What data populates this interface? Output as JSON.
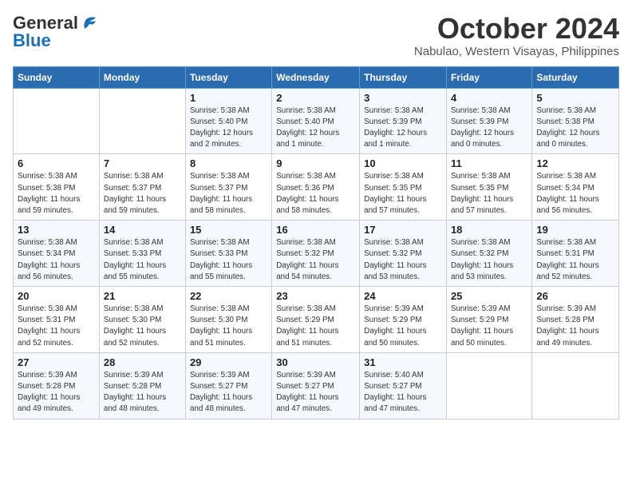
{
  "logo": {
    "line1": "General",
    "line2": "Blue"
  },
  "title": "October 2024",
  "location": "Nabulao, Western Visayas, Philippines",
  "days_header": [
    "Sunday",
    "Monday",
    "Tuesday",
    "Wednesday",
    "Thursday",
    "Friday",
    "Saturday"
  ],
  "weeks": [
    [
      {
        "day": "",
        "detail": ""
      },
      {
        "day": "",
        "detail": ""
      },
      {
        "day": "1",
        "detail": "Sunrise: 5:38 AM\nSunset: 5:40 PM\nDaylight: 12 hours\nand 2 minutes."
      },
      {
        "day": "2",
        "detail": "Sunrise: 5:38 AM\nSunset: 5:40 PM\nDaylight: 12 hours\nand 1 minute."
      },
      {
        "day": "3",
        "detail": "Sunrise: 5:38 AM\nSunset: 5:39 PM\nDaylight: 12 hours\nand 1 minute."
      },
      {
        "day": "4",
        "detail": "Sunrise: 5:38 AM\nSunset: 5:39 PM\nDaylight: 12 hours\nand 0 minutes."
      },
      {
        "day": "5",
        "detail": "Sunrise: 5:38 AM\nSunset: 5:38 PM\nDaylight: 12 hours\nand 0 minutes."
      }
    ],
    [
      {
        "day": "6",
        "detail": "Sunrise: 5:38 AM\nSunset: 5:38 PM\nDaylight: 11 hours\nand 59 minutes."
      },
      {
        "day": "7",
        "detail": "Sunrise: 5:38 AM\nSunset: 5:37 PM\nDaylight: 11 hours\nand 59 minutes."
      },
      {
        "day": "8",
        "detail": "Sunrise: 5:38 AM\nSunset: 5:37 PM\nDaylight: 11 hours\nand 58 minutes."
      },
      {
        "day": "9",
        "detail": "Sunrise: 5:38 AM\nSunset: 5:36 PM\nDaylight: 11 hours\nand 58 minutes."
      },
      {
        "day": "10",
        "detail": "Sunrise: 5:38 AM\nSunset: 5:35 PM\nDaylight: 11 hours\nand 57 minutes."
      },
      {
        "day": "11",
        "detail": "Sunrise: 5:38 AM\nSunset: 5:35 PM\nDaylight: 11 hours\nand 57 minutes."
      },
      {
        "day": "12",
        "detail": "Sunrise: 5:38 AM\nSunset: 5:34 PM\nDaylight: 11 hours\nand 56 minutes."
      }
    ],
    [
      {
        "day": "13",
        "detail": "Sunrise: 5:38 AM\nSunset: 5:34 PM\nDaylight: 11 hours\nand 56 minutes."
      },
      {
        "day": "14",
        "detail": "Sunrise: 5:38 AM\nSunset: 5:33 PM\nDaylight: 11 hours\nand 55 minutes."
      },
      {
        "day": "15",
        "detail": "Sunrise: 5:38 AM\nSunset: 5:33 PM\nDaylight: 11 hours\nand 55 minutes."
      },
      {
        "day": "16",
        "detail": "Sunrise: 5:38 AM\nSunset: 5:32 PM\nDaylight: 11 hours\nand 54 minutes."
      },
      {
        "day": "17",
        "detail": "Sunrise: 5:38 AM\nSunset: 5:32 PM\nDaylight: 11 hours\nand 53 minutes."
      },
      {
        "day": "18",
        "detail": "Sunrise: 5:38 AM\nSunset: 5:32 PM\nDaylight: 11 hours\nand 53 minutes."
      },
      {
        "day": "19",
        "detail": "Sunrise: 5:38 AM\nSunset: 5:31 PM\nDaylight: 11 hours\nand 52 minutes."
      }
    ],
    [
      {
        "day": "20",
        "detail": "Sunrise: 5:38 AM\nSunset: 5:31 PM\nDaylight: 11 hours\nand 52 minutes."
      },
      {
        "day": "21",
        "detail": "Sunrise: 5:38 AM\nSunset: 5:30 PM\nDaylight: 11 hours\nand 52 minutes."
      },
      {
        "day": "22",
        "detail": "Sunrise: 5:38 AM\nSunset: 5:30 PM\nDaylight: 11 hours\nand 51 minutes."
      },
      {
        "day": "23",
        "detail": "Sunrise: 5:38 AM\nSunset: 5:29 PM\nDaylight: 11 hours\nand 51 minutes."
      },
      {
        "day": "24",
        "detail": "Sunrise: 5:39 AM\nSunset: 5:29 PM\nDaylight: 11 hours\nand 50 minutes."
      },
      {
        "day": "25",
        "detail": "Sunrise: 5:39 AM\nSunset: 5:29 PM\nDaylight: 11 hours\nand 50 minutes."
      },
      {
        "day": "26",
        "detail": "Sunrise: 5:39 AM\nSunset: 5:28 PM\nDaylight: 11 hours\nand 49 minutes."
      }
    ],
    [
      {
        "day": "27",
        "detail": "Sunrise: 5:39 AM\nSunset: 5:28 PM\nDaylight: 11 hours\nand 49 minutes."
      },
      {
        "day": "28",
        "detail": "Sunrise: 5:39 AM\nSunset: 5:28 PM\nDaylight: 11 hours\nand 48 minutes."
      },
      {
        "day": "29",
        "detail": "Sunrise: 5:39 AM\nSunset: 5:27 PM\nDaylight: 11 hours\nand 48 minutes."
      },
      {
        "day": "30",
        "detail": "Sunrise: 5:39 AM\nSunset: 5:27 PM\nDaylight: 11 hours\nand 47 minutes."
      },
      {
        "day": "31",
        "detail": "Sunrise: 5:40 AM\nSunset: 5:27 PM\nDaylight: 11 hours\nand 47 minutes."
      },
      {
        "day": "",
        "detail": ""
      },
      {
        "day": "",
        "detail": ""
      }
    ]
  ]
}
